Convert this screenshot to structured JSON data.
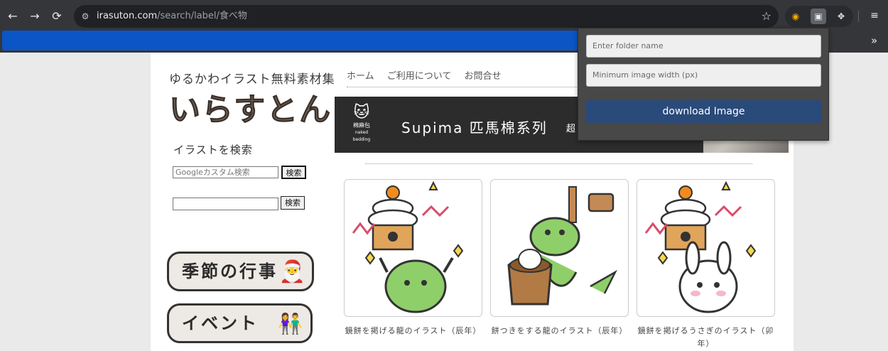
{
  "browser": {
    "nav": {
      "back": "←",
      "forward": "→",
      "reload": "⟳"
    },
    "url_host": "irasuton.com",
    "url_path": "/search/label/食べ物",
    "more_bookmarks": "»"
  },
  "site": {
    "logo_subtitle": "ゆるかわイラスト無料素材集",
    "logo_title": "いらすとん",
    "nav": [
      "ホーム",
      "ご利用について",
      "お問合せ"
    ],
    "search_title": "イラストを検索",
    "google_search_placeholder": "Googleカスタム検索",
    "search_button": "検索",
    "search_button2": "検索",
    "banners": {
      "season": "季節の行事",
      "event": "イベント"
    },
    "ad": {
      "brand": "棉麻包",
      "brand_sub": "naked bedding",
      "headline": "Supima 匹馬棉系列",
      "extra": "超"
    }
  },
  "cards": [
    {
      "caption": "鏡餅を掲げる龍のイラスト（辰年）"
    },
    {
      "caption": "餅つきをする龍のイラスト（辰年）"
    },
    {
      "caption": "鏡餅を掲げるうさぎのイラスト（卯年）"
    }
  ],
  "popup": {
    "folder_placeholder": "Enter folder name",
    "width_placeholder": "Minimum image width (px)",
    "download_label": "download Image"
  },
  "colors": {
    "chrome_bg": "#35363a",
    "omnibox_bg": "#202124",
    "redaction_blue": "#0b56c6",
    "popup_bg": "#484848",
    "download_button": "#2a4a7a"
  }
}
